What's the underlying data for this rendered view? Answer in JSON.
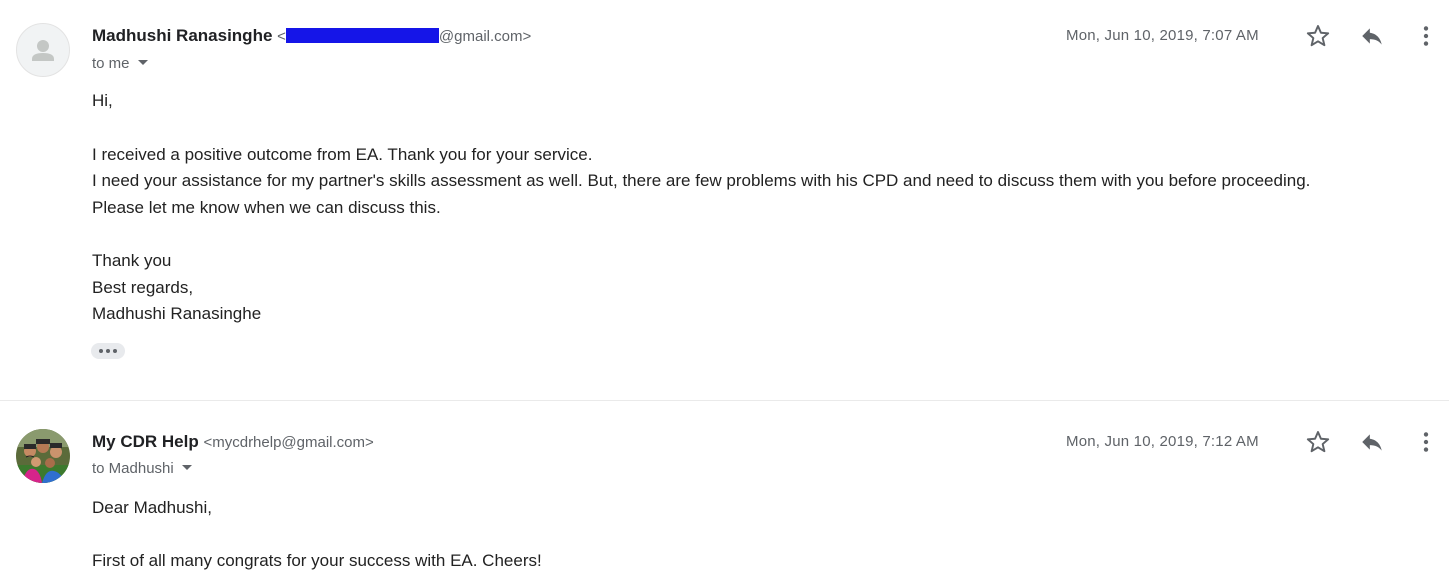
{
  "messages": [
    {
      "sender_name": "Madhushi Ranasinghe",
      "email_open": "<",
      "email_suffix": "@gmail.com>",
      "recipient": "to me",
      "date": "Mon, Jun 10, 2019, 7:07 AM",
      "body": [
        "Hi,",
        "I received a positive outcome from EA. Thank you for your service.",
        "I need your assistance for my partner's skills assessment as well. But, there are few problems with his CPD and need to discuss them with you before proceeding.",
        "Please let me know when we can discuss this.",
        "Thank you",
        "Best regards,",
        "Madhushi Ranasinghe"
      ]
    },
    {
      "sender_name": "My CDR Help",
      "email": "<mycdrhelp@gmail.com>",
      "recipient": "to Madhushi",
      "date": "Mon, Jun 10, 2019, 7:12 AM",
      "body": [
        "Dear Madhushi,",
        "First of all many congrats for your success with EA. Cheers!"
      ]
    }
  ],
  "icons": {
    "star": "star-icon",
    "reply": "reply-icon",
    "more": "more-vert-icon",
    "default_avatar": "person-icon",
    "trimmed": "ellipsis-icon"
  },
  "colors": {
    "redaction": "#1515e8",
    "secondary_text": "#5f6368",
    "primary_text": "#222222"
  }
}
